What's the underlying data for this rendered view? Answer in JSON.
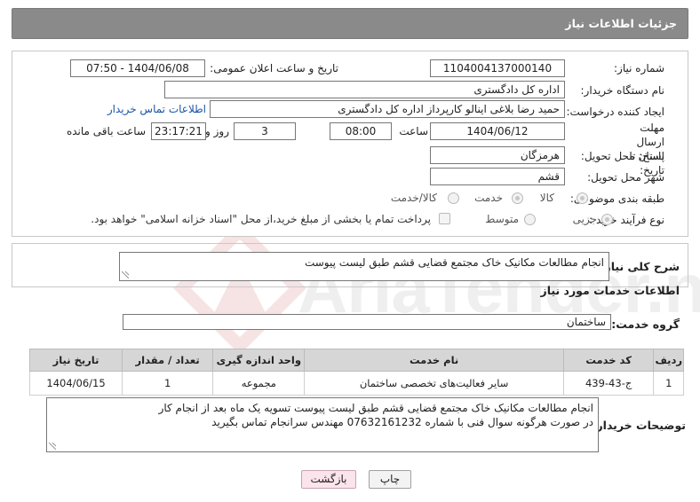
{
  "header": {
    "title": "جزئیات اطلاعات نیاز"
  },
  "fields": {
    "need_number_label": "شماره نیاز:",
    "need_number": "1104004137000140",
    "announce_label": "تاریخ و ساعت اعلان عمومی:",
    "announce_value": "1404/06/08 - 07:50",
    "buyer_org_label": "نام دستگاه خریدار:",
    "buyer_org": "اداره کل دادگستری",
    "creator_label": "ایجاد کننده درخواست:",
    "creator": "حمید رضا  بلاغی اینالو کارپرداز اداره کل دادگستری",
    "contact_link": "اطلاعات تماس خریدار",
    "deadline_label": "مهلت ارسال پاسخ: تا تاریخ:",
    "deadline_date": "1404/06/12",
    "time_label": "ساعت",
    "deadline_time": "08:00",
    "days_value": "3",
    "days_label": "روز و",
    "remaining_time": "23:17:21",
    "remaining_label": "ساعت باقی مانده",
    "province_label": "استان محل تحویل:",
    "province": "هرمزگان",
    "city_label": "شهر محل تحویل:",
    "city": "قشم",
    "category_label": "طبقه بندی موضوعی:",
    "category_options": [
      "کالا",
      "خدمت",
      "کالا/خدمت"
    ],
    "process_label": "نوع فرآیند خرید :",
    "process_options": [
      "جزیی",
      "متوسط"
    ],
    "payment_note": "پرداخت تمام یا بخشی از مبلغ خرید،از محل \"اسناد خزانه اسلامی\" خواهد بود."
  },
  "description": {
    "label": "شرح کلی نیاز:",
    "text": "انجام مطالعات مکانیک خاک  مجتمع قضایی قشم طبق لیست پیوست"
  },
  "services": {
    "section_title": "اطلاعات خدمات مورد نیاز",
    "group_label": "گروه خدمت:",
    "group_value": "ساختمان",
    "columns": [
      "ردیف",
      "کد خدمت",
      "نام خدمت",
      "واحد اندازه گیری",
      "تعداد / مقدار",
      "تاریخ نیاز"
    ],
    "rows": [
      [
        "1",
        "ج-43-439",
        "سایر فعالیت‌های تخصصی ساختمان",
        "مجموعه",
        "1",
        "1404/06/15"
      ]
    ]
  },
  "buyer_notes": {
    "label": "توضیحات خریدار:",
    "line1": "انجام مطالعات مکانیک خاک  مجتمع قضایی قشم طبق لیست پیوست تسویه یک ماه بعد از انجام کار",
    "line2": "در صورت هرگونه سوال فنی با شماره 07632161232 مهندس سرانجام تماس بگیرید"
  },
  "buttons": {
    "print": "چاپ",
    "back": "بازگشت"
  },
  "watermark": "AriaTender.net",
  "colors": {
    "header_bg": "#8a8a8a",
    "link": "#1a55a8",
    "back_button_bg": "#fbe4ec"
  }
}
